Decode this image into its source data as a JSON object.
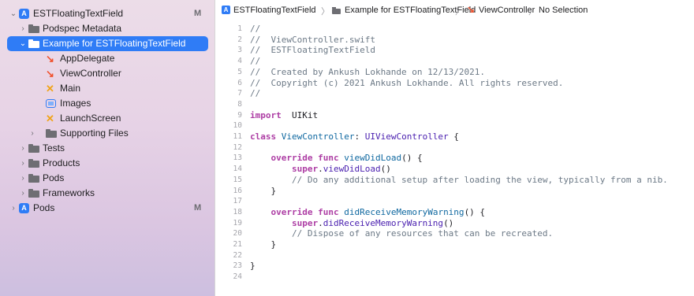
{
  "sidebar": {
    "items": [
      {
        "label": "ESTFloatingTextField",
        "disclosure": "⌄",
        "icon": "xcode-project-icon",
        "badge": "M",
        "selected": false
      },
      {
        "label": "Podspec Metadata",
        "disclosure": "›",
        "icon": "folder-icon",
        "badge": "",
        "selected": false
      },
      {
        "label": "Example for ESTFloatingTextField",
        "disclosure": "⌄",
        "icon": "folder-icon",
        "badge": "",
        "selected": true
      },
      {
        "label": "AppDelegate",
        "disclosure": "",
        "icon": "swift-file-icon",
        "badge": "",
        "selected": false
      },
      {
        "label": "ViewController",
        "disclosure": "",
        "icon": "swift-file-icon",
        "badge": "",
        "selected": false
      },
      {
        "label": "Main",
        "disclosure": "",
        "icon": "storyboard-icon",
        "badge": "",
        "selected": false
      },
      {
        "label": "Images",
        "disclosure": "",
        "icon": "asset-catalog-icon",
        "badge": "",
        "selected": false
      },
      {
        "label": "LaunchScreen",
        "disclosure": "",
        "icon": "storyboard-icon",
        "badge": "",
        "selected": false
      },
      {
        "label": "Supporting Files",
        "disclosure": "›",
        "icon": "folder-icon",
        "badge": "",
        "selected": false
      },
      {
        "label": "Tests",
        "disclosure": "›",
        "icon": "folder-icon",
        "badge": "",
        "selected": false
      },
      {
        "label": "Products",
        "disclosure": "›",
        "icon": "folder-icon",
        "badge": "",
        "selected": false
      },
      {
        "label": "Pods",
        "disclosure": "›",
        "icon": "folder-icon",
        "badge": "",
        "selected": false
      },
      {
        "label": "Frameworks",
        "disclosure": "›",
        "icon": "folder-icon",
        "badge": "",
        "selected": false
      },
      {
        "label": "Pods",
        "disclosure": "›",
        "icon": "xcode-project-icon",
        "badge": "M",
        "selected": false
      }
    ]
  },
  "jumpbar": {
    "items": [
      "ESTFloatingTextField",
      "Example for ESTFloatingTextField",
      "ViewController",
      "No Selection"
    ]
  },
  "editor": {
    "lines": [
      {
        "n": "1",
        "t": [
          [
            "cm",
            "//"
          ]
        ]
      },
      {
        "n": "2",
        "t": [
          [
            "cm",
            "//  ViewController.swift"
          ]
        ]
      },
      {
        "n": "3",
        "t": [
          [
            "cm",
            "//  ESTFloatingTextField"
          ]
        ]
      },
      {
        "n": "4",
        "t": [
          [
            "cm",
            "//"
          ]
        ]
      },
      {
        "n": "5",
        "t": [
          [
            "cm",
            "//  Created by Ankush Lokhande on 12/13/2021."
          ]
        ]
      },
      {
        "n": "6",
        "t": [
          [
            "cm",
            "//  Copyright (c) 2021 Ankush Lokhande. All rights reserved."
          ]
        ]
      },
      {
        "n": "7",
        "t": [
          [
            "cm",
            "//"
          ]
        ]
      },
      {
        "n": "8",
        "t": []
      },
      {
        "n": "9",
        "t": [
          [
            "kw",
            "import"
          ],
          [
            "",
            "  UIKit"
          ]
        ]
      },
      {
        "n": "10",
        "t": []
      },
      {
        "n": "11",
        "t": [
          [
            "kw",
            "class"
          ],
          [
            "",
            " "
          ],
          [
            "fn",
            "ViewController"
          ],
          [
            "",
            ": "
          ],
          [
            "ty",
            "UIViewController"
          ],
          [
            "",
            " {"
          ]
        ]
      },
      {
        "n": "12",
        "t": []
      },
      {
        "n": "13",
        "t": [
          [
            "",
            "    "
          ],
          [
            "kw",
            "override"
          ],
          [
            "",
            " "
          ],
          [
            "kw",
            "func"
          ],
          [
            "",
            " "
          ],
          [
            "fn",
            "viewDidLoad"
          ],
          [
            "",
            "() {"
          ]
        ]
      },
      {
        "n": "14",
        "t": [
          [
            "",
            "        "
          ],
          [
            "kw",
            "super"
          ],
          [
            "",
            "."
          ],
          [
            "ty",
            "viewDidLoad"
          ],
          [
            "",
            "()"
          ]
        ]
      },
      {
        "n": "15",
        "t": [
          [
            "",
            "        "
          ],
          [
            "cm",
            "// Do any additional setup after loading the view, typically from a nib."
          ]
        ]
      },
      {
        "n": "16",
        "t": [
          [
            "",
            "    }"
          ]
        ]
      },
      {
        "n": "17",
        "t": []
      },
      {
        "n": "18",
        "t": [
          [
            "",
            "    "
          ],
          [
            "kw",
            "override"
          ],
          [
            "",
            " "
          ],
          [
            "kw",
            "func"
          ],
          [
            "",
            " "
          ],
          [
            "fn",
            "didReceiveMemoryWarning"
          ],
          [
            "",
            "() {"
          ]
        ]
      },
      {
        "n": "19",
        "t": [
          [
            "",
            "        "
          ],
          [
            "kw",
            "super"
          ],
          [
            "",
            "."
          ],
          [
            "ty",
            "didReceiveMemoryWarning"
          ],
          [
            "",
            "()"
          ]
        ]
      },
      {
        "n": "20",
        "t": [
          [
            "",
            "        "
          ],
          [
            "cm",
            "// Dispose of any resources that can be recreated."
          ]
        ]
      },
      {
        "n": "21",
        "t": [
          [
            "",
            "    }"
          ]
        ]
      },
      {
        "n": "22",
        "t": []
      },
      {
        "n": "23",
        "t": [
          [
            "",
            "}"
          ]
        ]
      },
      {
        "n": "24",
        "t": []
      }
    ]
  },
  "colors": {
    "accent": "#2f7cf6",
    "swift": "#f0522e",
    "storyboard": "#f0a41a",
    "keyword": "#ad3da4",
    "comment": "#6c7986"
  }
}
